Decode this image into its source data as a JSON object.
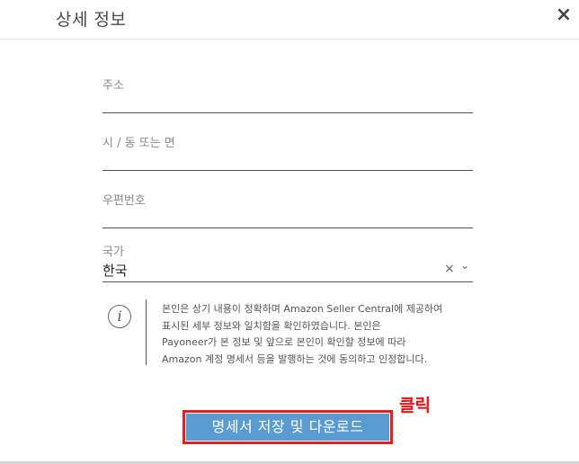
{
  "header": {
    "title": "상세 정보",
    "close_glyph": "×"
  },
  "form": {
    "address_label": "주소",
    "address_value": "",
    "city_label": "시 / 동 또는 면",
    "city_value": "",
    "postal_label": "우편번호",
    "postal_value": "",
    "country_label": "국가",
    "country_value": "한국",
    "country_clear_glyph": "×",
    "country_dropdown_glyph": "⌄"
  },
  "notice": {
    "icon_glyph": "i",
    "lines": [
      "본인은 상기 내용이 정확하며 Amazon Seller Central에 제공하여",
      "표시된 세부 정보와 일치함을 확인하였습니다. 본인은",
      "Payoneer가 본 정보 및 앞으로 본인이 확인할 정보에 따라",
      "Amazon 계정 명세서 등을 발행하는 것에 동의하고 인정합니다."
    ]
  },
  "annotation": {
    "click_label": "클릭",
    "highlight_color": "#e81f1f"
  },
  "actions": {
    "save_download_label": "명세서 저장 및 다운로드",
    "button_color": "#5a9bd2"
  }
}
